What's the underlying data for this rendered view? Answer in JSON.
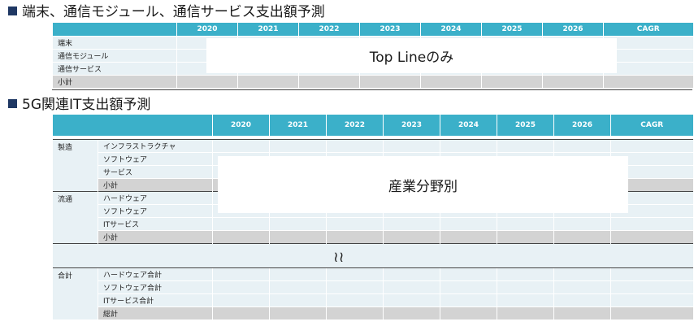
{
  "section1": {
    "title": "端末、通信モジュール、通信サービス支出額予測",
    "columns": [
      "2020",
      "2021",
      "2022",
      "2023",
      "2024",
      "2025",
      "2026",
      "CAGR"
    ],
    "rows": [
      {
        "label": "端末"
      },
      {
        "label": "通信モジュール"
      },
      {
        "label": "通信サービス"
      },
      {
        "label": "小計"
      }
    ],
    "overlay": "Top Lineのみ"
  },
  "section2": {
    "title": "5G関連IT支出額予測",
    "columns": [
      "2020",
      "2021",
      "2022",
      "2023",
      "2024",
      "2025",
      "2026",
      "CAGR"
    ],
    "groups": [
      {
        "name": "製造",
        "rows": [
          "インフラストラクチャ",
          "ソフトウェア",
          "サービス",
          "小計"
        ]
      },
      {
        "name": "流通",
        "rows": [
          "ハードウェア",
          "ソフトウェア",
          "ITサービス",
          "小計"
        ]
      },
      {
        "name": "合計",
        "rows": [
          "ハードウェア合計",
          "ソフトウェア合計",
          "ITサービス合計",
          "総計"
        ]
      }
    ],
    "overlay": "産業分野別",
    "ellipsis_glyph": "≀≀"
  }
}
